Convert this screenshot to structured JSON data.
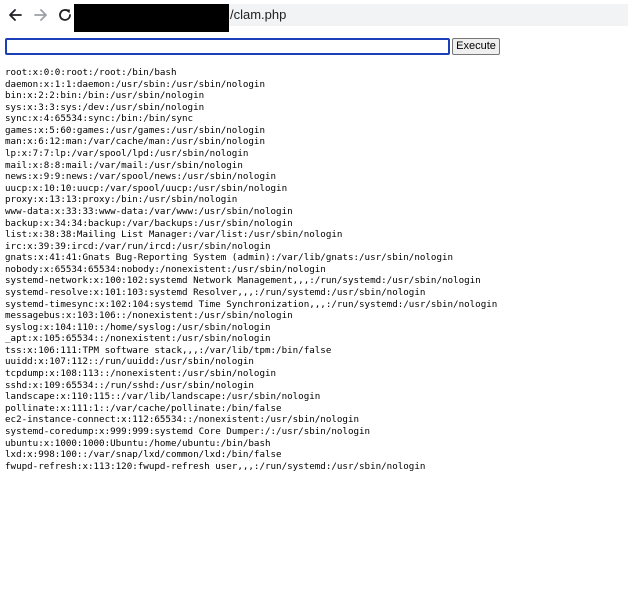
{
  "browser": {
    "back_icon": "arrow-left-icon",
    "forward_icon": "arrow-right-icon",
    "reload_icon": "reload-icon",
    "url_visible": "/clam.php"
  },
  "form": {
    "command_value": "",
    "execute_label": "Execute"
  },
  "output_lines": [
    "root:x:0:0:root:/root:/bin/bash",
    "daemon:x:1:1:daemon:/usr/sbin:/usr/sbin/nologin",
    "bin:x:2:2:bin:/bin:/usr/sbin/nologin",
    "sys:x:3:3:sys:/dev:/usr/sbin/nologin",
    "sync:x:4:65534:sync:/bin:/bin/sync",
    "games:x:5:60:games:/usr/games:/usr/sbin/nologin",
    "man:x:6:12:man:/var/cache/man:/usr/sbin/nologin",
    "lp:x:7:7:lp:/var/spool/lpd:/usr/sbin/nologin",
    "mail:x:8:8:mail:/var/mail:/usr/sbin/nologin",
    "news:x:9:9:news:/var/spool/news:/usr/sbin/nologin",
    "uucp:x:10:10:uucp:/var/spool/uucp:/usr/sbin/nologin",
    "proxy:x:13:13:proxy:/bin:/usr/sbin/nologin",
    "www-data:x:33:33:www-data:/var/www:/usr/sbin/nologin",
    "backup:x:34:34:backup:/var/backups:/usr/sbin/nologin",
    "list:x:38:38:Mailing List Manager:/var/list:/usr/sbin/nologin",
    "irc:x:39:39:ircd:/var/run/ircd:/usr/sbin/nologin",
    "gnats:x:41:41:Gnats Bug-Reporting System (admin):/var/lib/gnats:/usr/sbin/nologin",
    "nobody:x:65534:65534:nobody:/nonexistent:/usr/sbin/nologin",
    "systemd-network:x:100:102:systemd Network Management,,,:/run/systemd:/usr/sbin/nologin",
    "systemd-resolve:x:101:103:systemd Resolver,,,:/run/systemd:/usr/sbin/nologin",
    "systemd-timesync:x:102:104:systemd Time Synchronization,,,:/run/systemd:/usr/sbin/nologin",
    "messagebus:x:103:106::/nonexistent:/usr/sbin/nologin",
    "syslog:x:104:110::/home/syslog:/usr/sbin/nologin",
    "_apt:x:105:65534::/nonexistent:/usr/sbin/nologin",
    "tss:x:106:111:TPM software stack,,,:/var/lib/tpm:/bin/false",
    "uuidd:x:107:112::/run/uuidd:/usr/sbin/nologin",
    "tcpdump:x:108:113::/nonexistent:/usr/sbin/nologin",
    "sshd:x:109:65534::/run/sshd:/usr/sbin/nologin",
    "landscape:x:110:115::/var/lib/landscape:/usr/sbin/nologin",
    "pollinate:x:111:1::/var/cache/pollinate:/bin/false",
    "ec2-instance-connect:x:112:65534::/nonexistent:/usr/sbin/nologin",
    "systemd-coredump:x:999:999:systemd Core Dumper:/:/usr/sbin/nologin",
    "ubuntu:x:1000:1000:Ubuntu:/home/ubuntu:/bin/bash",
    "lxd:x:998:100::/var/snap/lxd/common/lxd:/bin/false",
    "fwupd-refresh:x:113:120:fwupd-refresh user,,,:/run/systemd:/usr/sbin/nologin"
  ]
}
